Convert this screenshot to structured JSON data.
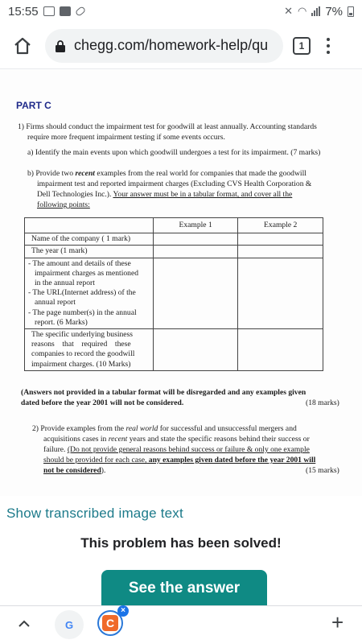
{
  "status_bar": {
    "time": "15:55",
    "battery": "7%"
  },
  "browser": {
    "url": "chegg.com/homework-help/qu",
    "tab_count": "1"
  },
  "question": {
    "part": "PART C",
    "q1_lines": [
      "1) Firms should conduct the impairment test for goodwill at least annually. Accounting standards",
      "require more frequent impairment testing if some events occurs."
    ],
    "q1a": "a) Identify the main events upon which goodwill undergoes a test for its impairment. (7 marks)",
    "q1b_line1_pre": "b) Provide two ",
    "q1b_line1_it": "recent",
    "q1b_line1_post": " examples from the real world for companies that made the goodwill",
    "q1b_line2": "impairment test and reported impairment charges (Excluding CVS Health Corporation &",
    "q1b_line3_pre": "Dell Technologies Inc.). ",
    "q1b_line3_u": "Your answer must be in a tabular format, and cover all the",
    "q1b_line4_u": "following points:",
    "table": {
      "col1": "Example 1",
      "col2": "Example 2",
      "rows": [
        [
          "Name of the company  ( 1 mark)"
        ],
        [
          "The year (1 mark)"
        ],
        [
          "- The amount and details of these",
          "impairment charges as mentioned",
          "in the annual report",
          "- The URL(Internet address) of the",
          "annual report",
          "- The page number(s) in the annual",
          "report. (6 Marks)"
        ],
        [
          "The specific underlying business",
          "reasons    that    required    these",
          "companies to record the goodwill",
          "impairment charges. (10 Marks)"
        ]
      ]
    },
    "note_line1": "(Answers not provided in a tabular format will be disregarded and any examples given",
    "note_line2": "dated before the year 2001 will not be considered.",
    "note_marks": "(18 marks)",
    "q2_line1_pre": "2)  Provide examples from the ",
    "q2_line1_it": "real world",
    "q2_line1_post": " for successful and unsuccessful mergers and",
    "q2_line2_pre": "acquisitions cases in ",
    "q2_line2_it": "recent",
    "q2_line2_post": " years and state the specific reasons behind their success or",
    "q2_line3_pre": "failure. ",
    "q2_line3_u": "(Do not provide general reasons behind success or failure & only one example",
    "q2_line4_u": "should be provided for each case,",
    "q2_line4_ub": " any examples given dated before the year 2001 will",
    "q2_line5_ub": "not be considered",
    "q2_line5_post": ").",
    "q2_marks": "(15 marks)"
  },
  "page": {
    "transcribed_link": "Show transcribed image text",
    "solved_text": "This problem has been solved!",
    "answer_button": "See the answer"
  },
  "bottom_bar": {
    "google_label": "G",
    "chegg_label": "C",
    "close_label": "×",
    "new_tab_label": "+"
  }
}
